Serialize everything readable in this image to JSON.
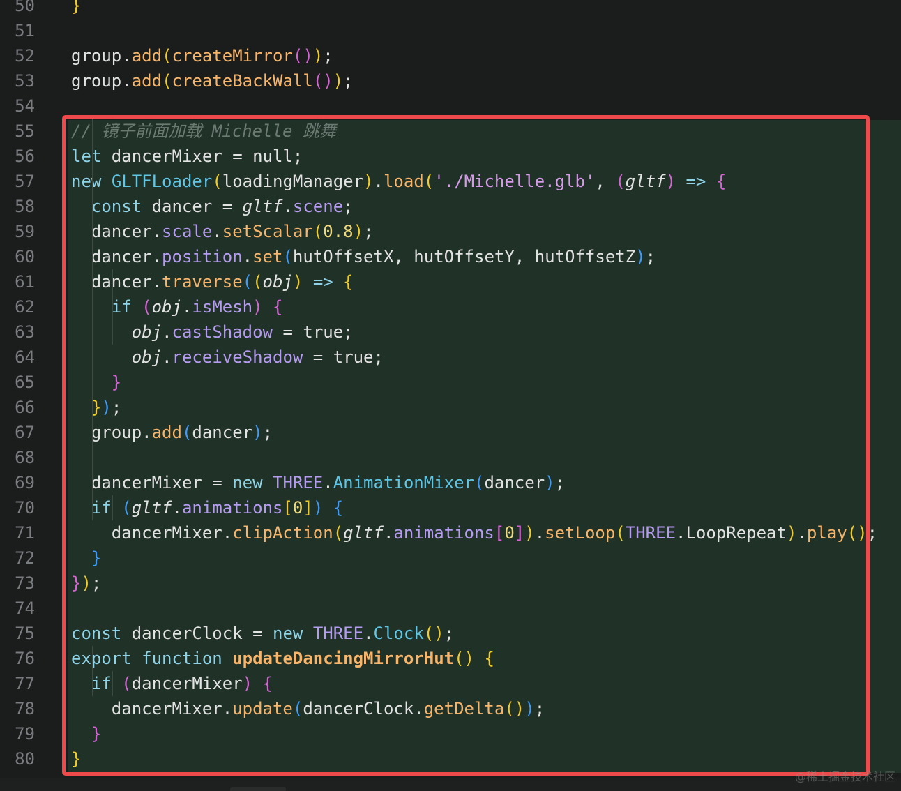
{
  "top_fragment": {
    "line_number": "50",
    "code": "}"
  },
  "lines": [
    {
      "n": "51",
      "tokens": []
    },
    {
      "n": "52",
      "tokens": [
        [
          "tx",
          "group."
        ],
        [
          "fn",
          "add"
        ],
        [
          "py",
          "("
        ],
        [
          "fn",
          "createMirror"
        ],
        [
          "pp",
          "()"
        ],
        [
          "py",
          ")"
        ],
        [
          "tx",
          ";"
        ]
      ]
    },
    {
      "n": "53",
      "tokens": [
        [
          "tx",
          "group."
        ],
        [
          "fn",
          "add"
        ],
        [
          "py",
          "("
        ],
        [
          "fn",
          "createBackWall"
        ],
        [
          "pp",
          "()"
        ],
        [
          "py",
          ")"
        ],
        [
          "tx",
          ";"
        ]
      ]
    },
    {
      "n": "54",
      "tokens": []
    },
    {
      "n": "55",
      "tokens": [
        [
          "cm",
          "// 镜子前面加载 Michelle 跳舞"
        ]
      ]
    },
    {
      "n": "56",
      "tokens": [
        [
          "kw",
          "let"
        ],
        [
          "tx",
          " dancerMixer = null;"
        ]
      ]
    },
    {
      "n": "57",
      "tokens": [
        [
          "kw",
          "new"
        ],
        [
          "tx",
          " "
        ],
        [
          "type",
          "GLTFLoader"
        ],
        [
          "py",
          "("
        ],
        [
          "tx",
          "loadingManager"
        ],
        [
          "py",
          ")"
        ],
        [
          "tx",
          "."
        ],
        [
          "fn",
          "load"
        ],
        [
          "py",
          "("
        ],
        [
          "str",
          "'./Michelle.glb'"
        ],
        [
          "tx",
          ", "
        ],
        [
          "pp",
          "("
        ],
        [
          "it",
          "gltf"
        ],
        [
          "pp",
          ")"
        ],
        [
          "tx",
          " "
        ],
        [
          "kw",
          "=>"
        ],
        [
          "tx",
          " "
        ],
        [
          "pp",
          "{"
        ]
      ]
    },
    {
      "n": "58",
      "tokens": [
        [
          "tx",
          "  "
        ],
        [
          "kw",
          "const"
        ],
        [
          "tx",
          " dancer = "
        ],
        [
          "it",
          "gltf"
        ],
        [
          "tx",
          "."
        ],
        [
          "prop",
          "scene"
        ],
        [
          "tx",
          ";"
        ]
      ]
    },
    {
      "n": "59",
      "tokens": [
        [
          "tx",
          "  dancer."
        ],
        [
          "prop",
          "scale"
        ],
        [
          "tx",
          "."
        ],
        [
          "fn",
          "setScalar"
        ],
        [
          "py",
          "("
        ],
        [
          "num",
          "0.8"
        ],
        [
          "py",
          ")"
        ],
        [
          "tx",
          ";"
        ]
      ]
    },
    {
      "n": "60",
      "tokens": [
        [
          "tx",
          "  dancer."
        ],
        [
          "prop",
          "position"
        ],
        [
          "tx",
          "."
        ],
        [
          "fn",
          "set"
        ],
        [
          "pb",
          "("
        ],
        [
          "tx",
          "hutOffsetX, hutOffsetY, hutOffsetZ"
        ],
        [
          "pb",
          ")"
        ],
        [
          "tx",
          ";"
        ]
      ]
    },
    {
      "n": "61",
      "tokens": [
        [
          "tx",
          "  dancer."
        ],
        [
          "fn",
          "traverse"
        ],
        [
          "pb",
          "("
        ],
        [
          "py",
          "("
        ],
        [
          "it",
          "obj"
        ],
        [
          "py",
          ")"
        ],
        [
          "tx",
          " "
        ],
        [
          "kw",
          "=>"
        ],
        [
          "tx",
          " "
        ],
        [
          "py",
          "{"
        ]
      ]
    },
    {
      "n": "62",
      "tokens": [
        [
          "tx",
          "    "
        ],
        [
          "kw",
          "if"
        ],
        [
          "tx",
          " "
        ],
        [
          "pp",
          "("
        ],
        [
          "it",
          "obj"
        ],
        [
          "tx",
          "."
        ],
        [
          "prop",
          "isMesh"
        ],
        [
          "pp",
          ")"
        ],
        [
          "tx",
          " "
        ],
        [
          "pp",
          "{"
        ]
      ]
    },
    {
      "n": "63",
      "tokens": [
        [
          "tx",
          "      "
        ],
        [
          "it",
          "obj"
        ],
        [
          "tx",
          "."
        ],
        [
          "prop",
          "castShadow"
        ],
        [
          "tx",
          " = true;"
        ]
      ]
    },
    {
      "n": "64",
      "tokens": [
        [
          "tx",
          "      "
        ],
        [
          "it",
          "obj"
        ],
        [
          "tx",
          "."
        ],
        [
          "prop",
          "receiveShadow"
        ],
        [
          "tx",
          " = true;"
        ]
      ]
    },
    {
      "n": "65",
      "tokens": [
        [
          "tx",
          "    "
        ],
        [
          "pp",
          "}"
        ]
      ]
    },
    {
      "n": "66",
      "tokens": [
        [
          "tx",
          "  "
        ],
        [
          "py",
          "}"
        ],
        [
          "pb",
          ")"
        ],
        [
          "tx",
          ";"
        ]
      ]
    },
    {
      "n": "67",
      "tokens": [
        [
          "tx",
          "  group."
        ],
        [
          "fn",
          "add"
        ],
        [
          "pb",
          "("
        ],
        [
          "tx",
          "dancer"
        ],
        [
          "pb",
          ")"
        ],
        [
          "tx",
          ";"
        ]
      ]
    },
    {
      "n": "68",
      "tokens": []
    },
    {
      "n": "69",
      "tokens": [
        [
          "tx",
          "  dancerMixer = "
        ],
        [
          "kw",
          "new"
        ],
        [
          "tx",
          " "
        ],
        [
          "prop",
          "THREE"
        ],
        [
          "tx",
          "."
        ],
        [
          "type",
          "AnimationMixer"
        ],
        [
          "pb",
          "("
        ],
        [
          "tx",
          "dancer"
        ],
        [
          "pb",
          ")"
        ],
        [
          "tx",
          ";"
        ]
      ]
    },
    {
      "n": "70",
      "tokens": [
        [
          "tx",
          "  "
        ],
        [
          "kw",
          "if"
        ],
        [
          "tx",
          " "
        ],
        [
          "pb",
          "("
        ],
        [
          "it",
          "gltf"
        ],
        [
          "tx",
          "."
        ],
        [
          "prop",
          "animations"
        ],
        [
          "py",
          "["
        ],
        [
          "num",
          "0"
        ],
        [
          "py",
          "]"
        ],
        [
          "pb",
          ")"
        ],
        [
          "tx",
          " "
        ],
        [
          "pb",
          "{"
        ]
      ]
    },
    {
      "n": "71",
      "tokens": [
        [
          "tx",
          "    dancerMixer."
        ],
        [
          "fn",
          "clipAction"
        ],
        [
          "py",
          "("
        ],
        [
          "it",
          "gltf"
        ],
        [
          "tx",
          "."
        ],
        [
          "prop",
          "animations"
        ],
        [
          "pp",
          "["
        ],
        [
          "num",
          "0"
        ],
        [
          "pp",
          "]"
        ],
        [
          "py",
          ")"
        ],
        [
          "tx",
          "."
        ],
        [
          "fn",
          "setLoop"
        ],
        [
          "py",
          "("
        ],
        [
          "prop",
          "THREE"
        ],
        [
          "tx",
          ".LoopRepeat"
        ],
        [
          "py",
          ")"
        ],
        [
          "tx",
          "."
        ],
        [
          "fn",
          "play"
        ],
        [
          "py",
          "()"
        ],
        [
          "tx",
          ";"
        ]
      ]
    },
    {
      "n": "72",
      "tokens": [
        [
          "tx",
          "  "
        ],
        [
          "pb",
          "}"
        ]
      ]
    },
    {
      "n": "73",
      "tokens": [
        [
          "pp",
          "}"
        ],
        [
          "py",
          ")"
        ],
        [
          "tx",
          ";"
        ]
      ]
    },
    {
      "n": "74",
      "tokens": []
    },
    {
      "n": "75",
      "tokens": [
        [
          "kw",
          "const"
        ],
        [
          "tx",
          " dancerClock = "
        ],
        [
          "kw",
          "new"
        ],
        [
          "tx",
          " "
        ],
        [
          "prop",
          "THREE"
        ],
        [
          "tx",
          "."
        ],
        [
          "type",
          "Clock"
        ],
        [
          "py",
          "()"
        ],
        [
          "tx",
          ";"
        ]
      ]
    },
    {
      "n": "76",
      "tokens": [
        [
          "kw",
          "export"
        ],
        [
          "tx",
          " "
        ],
        [
          "kw",
          "function"
        ],
        [
          "tx",
          " "
        ],
        [
          "fnb",
          "updateDancingMirrorHut"
        ],
        [
          "py",
          "()"
        ],
        [
          "tx",
          " "
        ],
        [
          "py",
          "{"
        ]
      ]
    },
    {
      "n": "77",
      "tokens": [
        [
          "tx",
          "  "
        ],
        [
          "kw",
          "if"
        ],
        [
          "tx",
          " "
        ],
        [
          "pp",
          "("
        ],
        [
          "tx",
          "dancerMixer"
        ],
        [
          "pp",
          ")"
        ],
        [
          "tx",
          " "
        ],
        [
          "pp",
          "{"
        ]
      ]
    },
    {
      "n": "78",
      "tokens": [
        [
          "tx",
          "    dancerMixer."
        ],
        [
          "fn",
          "update"
        ],
        [
          "pb",
          "("
        ],
        [
          "tx",
          "dancerClock."
        ],
        [
          "fn",
          "getDelta"
        ],
        [
          "py",
          "()"
        ],
        [
          "pb",
          ")"
        ],
        [
          "tx",
          ";"
        ]
      ]
    },
    {
      "n": "79",
      "tokens": [
        [
          "tx",
          "  "
        ],
        [
          "pp",
          "}"
        ]
      ]
    },
    {
      "n": "80",
      "tokens": [
        [
          "py",
          "}"
        ]
      ]
    }
  ],
  "watermark": "@稀土掘金技术社区",
  "colors": {
    "background": "#1b1c1c",
    "selection_background": "#203127",
    "selection_border": "#ee4a4b",
    "line_number": "#7a7d7f"
  }
}
